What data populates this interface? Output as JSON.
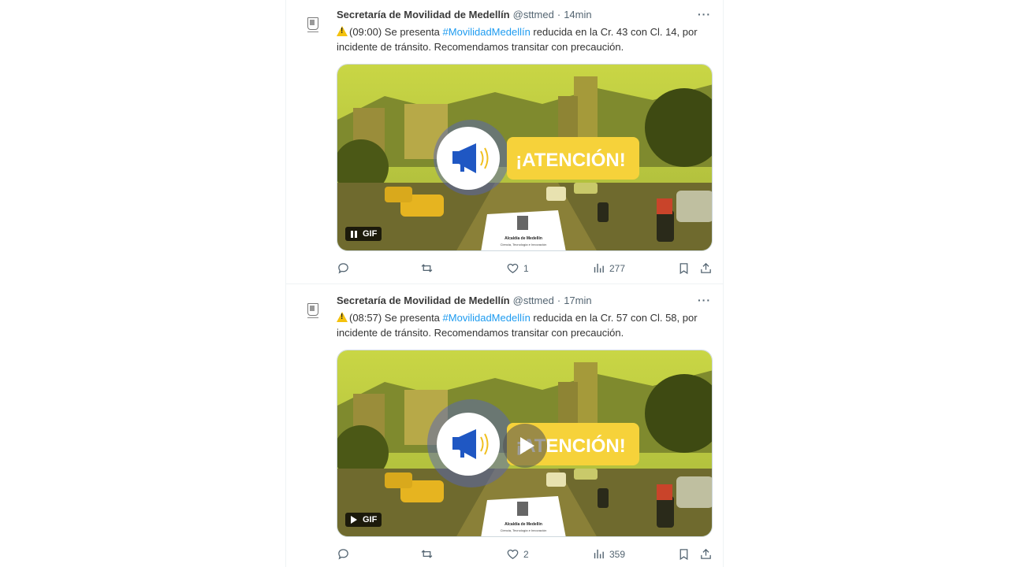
{
  "tweets": [
    {
      "author_name": "Secretaría de Movilidad de Medellín",
      "handle": "@sttmed",
      "time": "14min",
      "text_before": "(09:00) Se presenta ",
      "hashtag": "#MovilidadMedellín",
      "text_after": " reducida en la Cr. 43 con Cl. 14, por incidente de tránsito. Recomendamos transitar con precaución.",
      "media": {
        "banner_text": "¡ATENCIÓN!",
        "logo_title": "Alcaldía de Medellín",
        "logo_sub": "Ciencia, Tecnología e Innovación",
        "gif_label": "GIF",
        "state": "playing"
      },
      "stats": {
        "replies": "",
        "retweets": "",
        "likes": "1",
        "views": "277"
      }
    },
    {
      "author_name": "Secretaría de Movilidad de Medellín",
      "handle": "@sttmed",
      "time": "17min",
      "text_before": "(08:57) Se presenta ",
      "hashtag": "#MovilidadMedellín",
      "text_after": " reducida en la Cr. 57 con Cl. 58, por incidente de tránsito. Recomendamos transitar con precaución.",
      "media": {
        "banner_text": "¡ATENCIÓN!",
        "logo_title": "Alcaldía de Medellín",
        "logo_sub": "Ciencia, Tecnología e Innovación",
        "gif_label": "GIF",
        "state": "paused"
      },
      "stats": {
        "replies": "",
        "retweets": "",
        "likes": "2",
        "views": "359"
      }
    }
  ],
  "separator": "·",
  "more_label": "···",
  "colors": {
    "hashtag": "#1d9bf0",
    "secondary_text": "#536471",
    "banner_yellow": "#f6d23a",
    "megaphone_blue": "#1f57c3"
  }
}
